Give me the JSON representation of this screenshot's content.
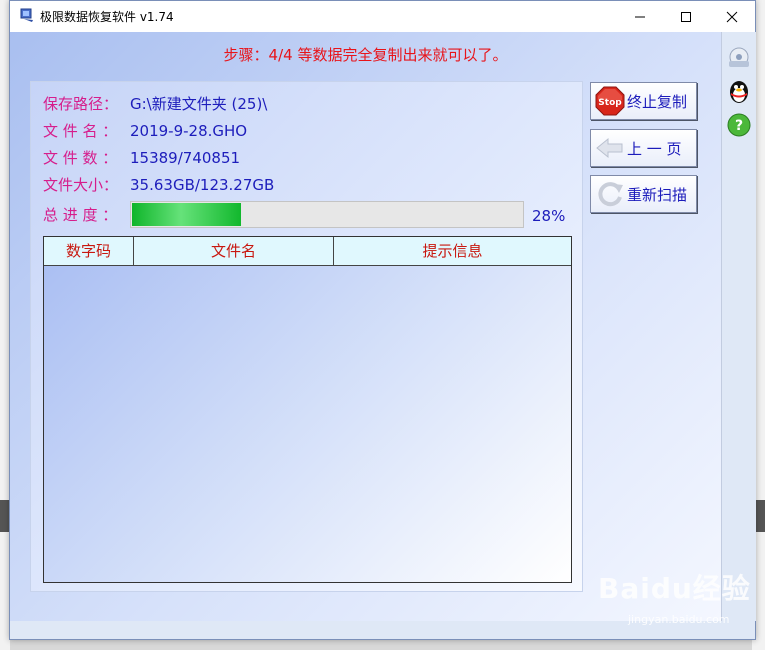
{
  "window": {
    "title": "极限数据恢复软件 v1.74"
  },
  "step": {
    "text": "步骤：4/4 等数据完全复制出来就可以了。"
  },
  "info": {
    "save_path_label": "保存路径：",
    "save_path_value": "G:\\新建文件夹 (25)\\",
    "file_name_label": "文 件 名 ：",
    "file_name_value": "2019-9-28.GHO",
    "file_count_label": "文 件 数 ：",
    "file_count_value": "15389/740851",
    "file_size_label": "文件大小：",
    "file_size_value": "35.63GB/123.27GB",
    "progress_label": "总 进 度 ："
  },
  "progress": {
    "percent": 28,
    "percent_text": "28%"
  },
  "table": {
    "columns": [
      "数字码",
      "文件名",
      "提示信息"
    ],
    "rows": []
  },
  "buttons": {
    "stop": "终止复制",
    "stop_icon_text": "Stop",
    "prev": "上 一 页",
    "rescan": "重新扫描"
  },
  "watermark": {
    "main": "Baidu经验",
    "sub": "jingyan.baidu.com"
  },
  "colors": {
    "accent_red": "#e8141a",
    "label_magenta": "#d61d8c",
    "value_blue": "#1d1dbb",
    "header_red": "#c8170f",
    "progress_green": "#12b82d"
  },
  "icons": {
    "app": "monitor-disk-icon",
    "stop": "stop-sign-icon",
    "prev": "arrow-left-icon",
    "rescan": "refresh-icon",
    "side": [
      "settings-icon",
      "qq-penguin-icon",
      "help-icon"
    ]
  }
}
